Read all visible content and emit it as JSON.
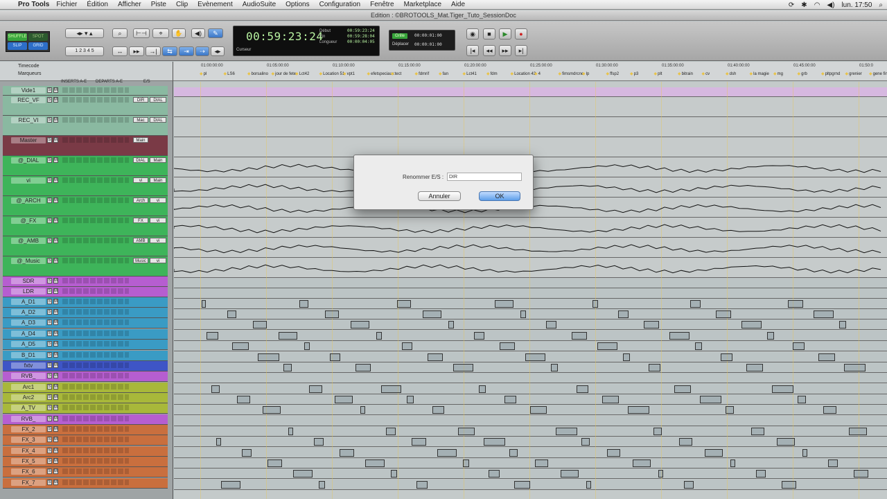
{
  "menubar": {
    "app": "Pro Tools",
    "items": [
      "Fichier",
      "Édition",
      "Afficher",
      "Piste",
      "Clip",
      "Evènement",
      "AudioSuite",
      "Options",
      "Configuration",
      "Fenêtre",
      "Marketplace",
      "Aide"
    ],
    "clock": "lun. 17:50"
  },
  "window": {
    "title": "Edition : ©BROTOOLS_Mat.Tiger_Tuto_SessionDoc"
  },
  "toolbar": {
    "modes": [
      "SHUFFLE",
      "SPOT",
      "SLIP",
      "GRID"
    ],
    "counter_main": "00:59:23:24",
    "counter_label": "Curseur",
    "sel_labels": [
      "Début",
      "Fin",
      "Longueur"
    ],
    "sel_values": [
      "00:59:23:24",
      "00:59:28:04",
      "00:00:04:05"
    ],
    "grid_label": "Grille",
    "grid_value": "00:00:01:00",
    "nudge_label": "Déplacer",
    "nudge_value": "00:00:01:00"
  },
  "ruler": {
    "timecode_label": "Timecode",
    "markers_label": "Marqueurs",
    "ticks": [
      "01:00:00:00",
      "01:05:00:00",
      "01:10:00:00",
      "01:15:00:00",
      "01:20:00:00",
      "01:25:00:00",
      "01:30:00:00",
      "01:35:00:00",
      "01:40:00:00",
      "01:45:00:00",
      "01:50:0"
    ],
    "markers": [
      "pl",
      "LS6",
      "borsalino",
      "jour de fete",
      "Lct42",
      "Location 51",
      "vpt1",
      "efetspeciaux",
      "tect",
      "fdmrif",
      "fan",
      "Lct41",
      "fdm",
      "Location 43",
      "4",
      "fimsmdrcne",
      "lp",
      "ffsp2",
      "p3",
      "plt",
      "bitrain",
      "cv",
      "dsh",
      "la magie",
      "mg",
      "grb",
      "pltpgrnd",
      "grenier",
      "gene fin"
    ]
  },
  "header": {
    "inserts": "INSERTS A-E",
    "sends": "DEPARTS A-E",
    "io": "E/S"
  },
  "tracks": [
    {
      "name": "Vide1",
      "io": "",
      "io2": ""
    },
    {
      "name": "REC_VF",
      "io": "DIR",
      "io2": "DIAL"
    },
    {
      "name": "REC_VI",
      "io": "Mac",
      "io2": "DIAL"
    },
    {
      "name": "Master",
      "io": "Main",
      "io2": ""
    },
    {
      "name": "@_DIAL",
      "io": "DIAL",
      "io2": "Main"
    },
    {
      "name": "vi",
      "io": "vi",
      "io2": "Main"
    },
    {
      "name": "@_ARCH",
      "io": "Arch",
      "io2": "vi"
    },
    {
      "name": "@_FX",
      "io": "FX",
      "io2": "vi"
    },
    {
      "name": "@_AMB",
      "io": "AMB",
      "io2": "vi"
    },
    {
      "name": "@_Music",
      "io": "Music",
      "io2": "vi"
    },
    {
      "name": "SDR",
      "io": "",
      "io2": ""
    },
    {
      "name": "LDR",
      "io": "",
      "io2": ""
    },
    {
      "name": "A_D1",
      "io": "",
      "io2": ""
    },
    {
      "name": "A_D2",
      "io": "",
      "io2": ""
    },
    {
      "name": "A_D3",
      "io": "",
      "io2": ""
    },
    {
      "name": "A_D4",
      "io": "",
      "io2": ""
    },
    {
      "name": "A_D5",
      "io": "",
      "io2": ""
    },
    {
      "name": "B_D1",
      "io": "",
      "io2": ""
    },
    {
      "name": "fxtv",
      "io": "",
      "io2": ""
    },
    {
      "name": "RVB_",
      "io": "",
      "io2": ""
    },
    {
      "name": "Arc1",
      "io": "",
      "io2": ""
    },
    {
      "name": "Arc2",
      "io": "",
      "io2": ""
    },
    {
      "name": "A_TV",
      "io": "",
      "io2": ""
    },
    {
      "name": "RVB_",
      "io": "",
      "io2": ""
    },
    {
      "name": "FX_2",
      "io": "",
      "io2": ""
    },
    {
      "name": "FX_3",
      "io": "",
      "io2": ""
    },
    {
      "name": "FX_4",
      "io": "",
      "io2": ""
    },
    {
      "name": "FX_5",
      "io": "",
      "io2": ""
    },
    {
      "name": "FX_6",
      "io": "",
      "io2": ""
    },
    {
      "name": "FX_7",
      "io": "",
      "io2": ""
    }
  ],
  "dialog": {
    "label": "Renommer E/S :",
    "value": "DIR",
    "cancel": "Annuler",
    "ok": "OK"
  }
}
